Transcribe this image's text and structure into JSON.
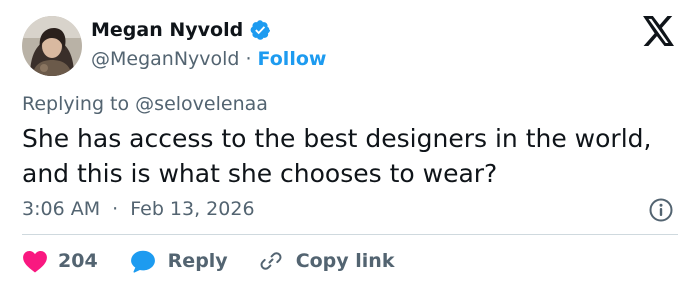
{
  "author": {
    "name": "Megan Nyvold",
    "handle": "@MeganNyvold",
    "separator": "·",
    "follow_label": "Follow"
  },
  "reply_context": {
    "prefix": "Replying to",
    "mention": "@selovelenaa"
  },
  "tweet": {
    "text_line1": "She has access to the best designers in the world,",
    "text_line2": "and this is what she chooses to wear?",
    "time": "3:06 AM",
    "separator": "·",
    "date": "Feb 13, 2026"
  },
  "actions": {
    "like_count": "204",
    "reply_label": "Reply",
    "copy_link_label": "Copy link"
  },
  "colors": {
    "accent": "#1d9bf0",
    "like": "#f91880",
    "secondary_text": "#536471",
    "divider": "#cfd9de"
  },
  "icons": [
    "avatar",
    "verified-badge-icon",
    "x-logo-icon",
    "info-icon",
    "heart-icon",
    "reply-bubble-icon",
    "link-icon"
  ]
}
